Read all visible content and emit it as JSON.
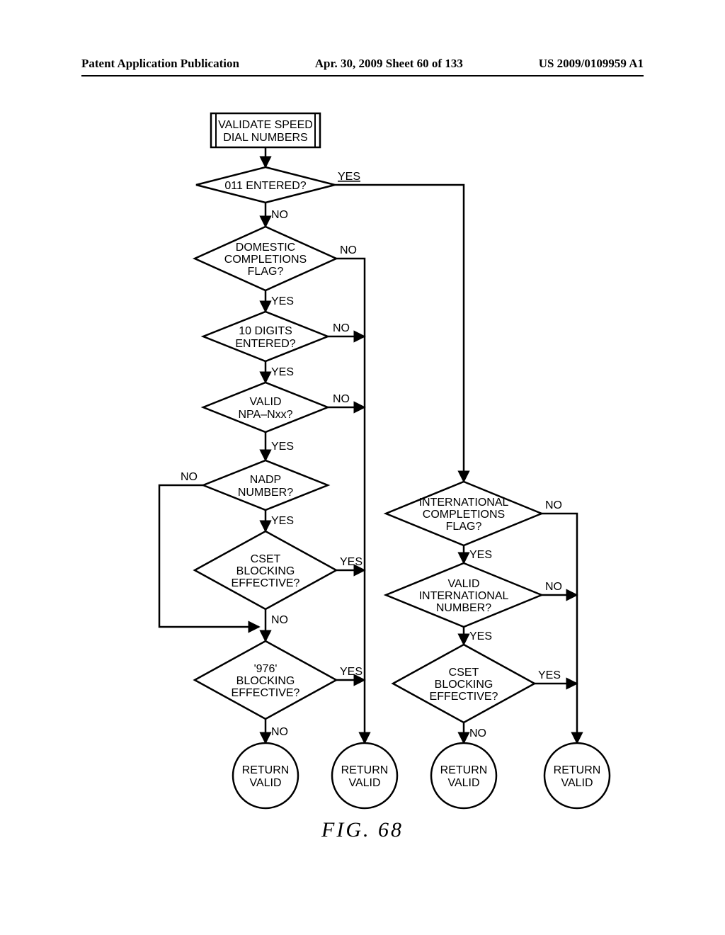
{
  "header": {
    "left": "Patent Application Publication",
    "center": "Apr. 30, 2009  Sheet 60 of 133",
    "right": "US 2009/0109959 A1"
  },
  "figure_label": "FIG.   68",
  "nodes": {
    "start": {
      "line1": "VALIDATE SPEED",
      "line2": "DIAL NUMBERS"
    },
    "d1": {
      "text": "011 ENTERED?"
    },
    "d2": {
      "line1": "DOMESTIC",
      "line2": "COMPLETIONS",
      "line3": "FLAG?"
    },
    "d3": {
      "line1": "10 DIGITS",
      "line2": "ENTERED?"
    },
    "d4": {
      "line1": "VALID",
      "line2": "NPA–Nxx?"
    },
    "d5": {
      "line1": "NADP",
      "line2": "NUMBER?"
    },
    "d6": {
      "line1": "CSET",
      "line2": "BLOCKING",
      "line3": "EFFECTIVE?"
    },
    "d7": {
      "line1": "'976'",
      "line2": "BLOCKING",
      "line3": "EFFECTIVE?"
    },
    "d8": {
      "line1": "INTERNATIONAL",
      "line2": "COMPLETIONS",
      "line3": "FLAG?"
    },
    "d9": {
      "line1": "VALID",
      "line2": "INTERNATIONAL",
      "line3": "NUMBER?"
    },
    "d10": {
      "line1": "CSET",
      "line2": "BLOCKING",
      "line3": "EFFECTIVE?"
    },
    "t1": {
      "line1": "RETURN",
      "line2": "VALID"
    },
    "t2": {
      "line1": "RETURN",
      "line2": "VALID"
    },
    "t3": {
      "line1": "RETURN",
      "line2": "VALID"
    },
    "t4": {
      "line1": "RETURN",
      "line2": "VALID"
    }
  },
  "edges": {
    "yes": "YES",
    "no": "NO"
  }
}
